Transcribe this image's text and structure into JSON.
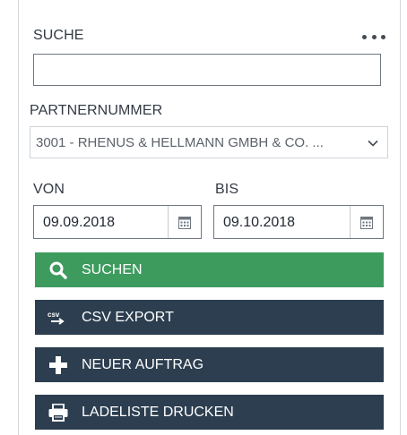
{
  "search": {
    "label": "SUCHE",
    "value": "",
    "placeholder": ""
  },
  "partner": {
    "label": "PARTNERNUMMER",
    "selected": "3001 - RHENUS & HELLMANN GMBH & CO. ..."
  },
  "date_range": {
    "from_label": "VON",
    "from_value": "09.09.2018",
    "to_label": "BIS",
    "to_value": "09.10.2018"
  },
  "buttons": {
    "search": "SUCHEN",
    "csv_export": "CSV EXPORT",
    "new_order": "NEUER AUFTRAG",
    "print_list": "LADELISTE DRUCKEN"
  },
  "icons": {
    "more": "more-horizontal-icon",
    "chevron": "chevron-down-icon",
    "calendar": "calendar-icon",
    "search": "search-icon",
    "csv": "csv-export-icon",
    "plus": "plus-icon",
    "print": "printer-icon"
  },
  "colors": {
    "search_button": "#3d9b5e",
    "dark_button": "#2c3e50",
    "text": "#333a44"
  }
}
